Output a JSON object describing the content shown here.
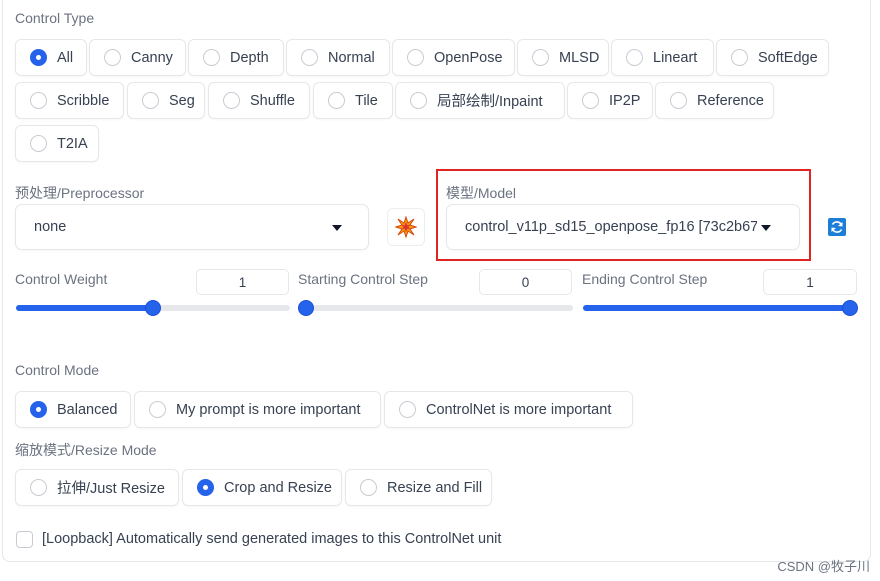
{
  "control_type": {
    "label": "Control Type",
    "row1": [
      "All",
      "Canny",
      "Depth",
      "Normal",
      "OpenPose",
      "MLSD",
      "Lineart",
      "SoftEdge"
    ],
    "row2": [
      "Scribble",
      "Seg",
      "Shuffle",
      "Tile",
      "局部绘制/Inpaint",
      "IP2P",
      "Reference"
    ],
    "row3": [
      "T2IA"
    ],
    "selected": "All"
  },
  "preprocessor": {
    "label": "预处理/Preprocessor",
    "value": "none"
  },
  "model": {
    "label": "模型/Model",
    "value": "control_v11p_sd15_openpose_fp16 [73c2b67"
  },
  "icons": {
    "run_preprocessor": "explosion-icon",
    "refresh": "refresh-icon"
  },
  "sliders": [
    {
      "label": "Control Weight",
      "value": "1",
      "fraction": 0.5
    },
    {
      "label": "Starting Control Step",
      "value": "0",
      "fraction": 0.0
    },
    {
      "label": "Ending Control Step",
      "value": "1",
      "fraction": 1.0
    }
  ],
  "control_mode": {
    "label": "Control Mode",
    "options": [
      "Balanced",
      "My prompt is more important",
      "ControlNet is more important"
    ],
    "selected": "Balanced"
  },
  "resize_mode": {
    "label": "缩放模式/Resize Mode",
    "options": [
      "拉伸/Just Resize",
      "Crop and Resize",
      "Resize and Fill"
    ],
    "selected": "Crop and Resize"
  },
  "loopback": {
    "label": "[Loopback] Automatically send generated images to this ControlNet unit",
    "checked": false
  },
  "watermark": "CSDN @牧子川",
  "colors": {
    "accent": "#2563eb",
    "highlight": "#e02424"
  }
}
